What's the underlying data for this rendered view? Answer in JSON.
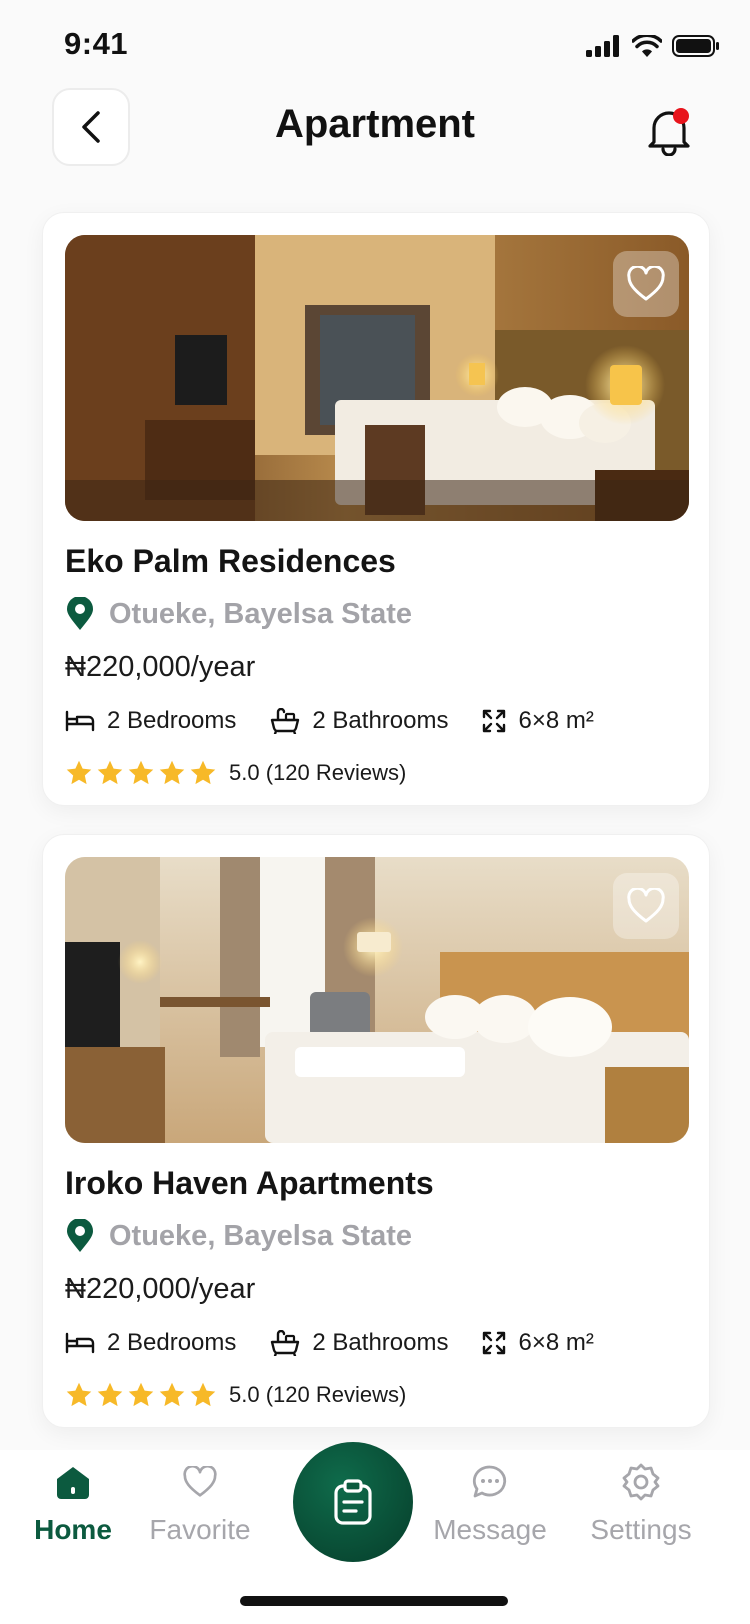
{
  "status_bar": {
    "time": "9:41"
  },
  "header": {
    "title": "Apartment"
  },
  "listings": [
    {
      "name": "Eko Palm Residences",
      "location": "Otueke, Bayelsa State",
      "price": "₦220,000/year",
      "bedrooms": "2 Bedrooms",
      "bathrooms": "2 Bathrooms",
      "area": "6×8 m²",
      "rating": 5,
      "rating_text": "5.0 (120 Reviews)"
    },
    {
      "name": "Iroko Haven Apartments",
      "location": "Otueke, Bayelsa State",
      "price": "₦220,000/year",
      "bedrooms": "2 Bedrooms",
      "bathrooms": "2 Bathrooms",
      "area": "6×8 m²",
      "rating": 5,
      "rating_text": "5.0 (120 Reviews)"
    }
  ],
  "nav": {
    "home": "Home",
    "favorite": "Favorite",
    "message": "Message",
    "settings": "Settings",
    "active": "home"
  },
  "colors": {
    "brand": "#0c5a3f",
    "star": "#f7b928",
    "notification_dot": "#e8141c",
    "muted_text": "#a3a3a8"
  },
  "icons": [
    "back-arrow-icon",
    "bell-icon",
    "heart-icon",
    "location-pin-icon",
    "bed-icon",
    "bathtub-icon",
    "area-icon",
    "star-icon",
    "home-icon",
    "chat-icon",
    "gear-icon",
    "clipboard-icon"
  ]
}
